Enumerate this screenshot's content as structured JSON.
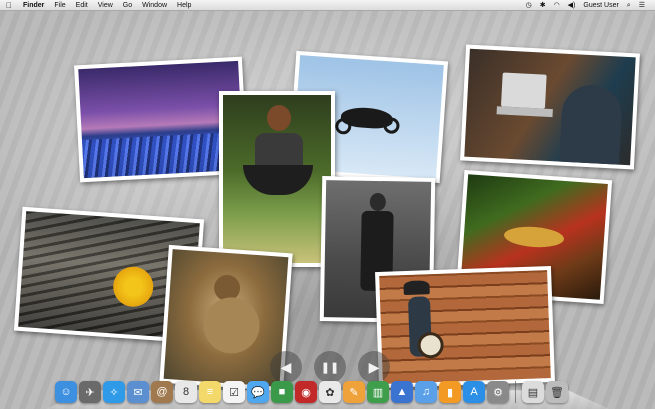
{
  "menubar": {
    "apple_icon": "apple-logo-icon",
    "app_name": "Finder",
    "items": [
      "File",
      "Edit",
      "View",
      "Go",
      "Window",
      "Help"
    ],
    "status_icons": [
      "wifi-icon",
      "bluetooth-icon",
      "speaker-icon",
      "time-machine-icon"
    ],
    "user_name": "Guest User",
    "extra_icons": [
      "search-icon",
      "list-icon"
    ]
  },
  "slideshow": {
    "photos": [
      {
        "name": "night-field-photo",
        "description_icon": "landscape"
      },
      {
        "name": "boy-on-swing-photo",
        "description_icon": "portrait"
      },
      {
        "name": "motocross-jump-photo",
        "description_icon": "sports"
      },
      {
        "name": "man-with-laptop-photo",
        "description_icon": "work"
      },
      {
        "name": "wood-chips-flower-photo",
        "description_icon": "nature"
      },
      {
        "name": "gosling-photo",
        "description_icon": "animal"
      },
      {
        "name": "soldier-in-rain-photo",
        "description_icon": "portrait"
      },
      {
        "name": "lizard-photo",
        "description_icon": "animal"
      },
      {
        "name": "banjo-player-photo",
        "description_icon": "music"
      }
    ],
    "controls": {
      "previous_icon": "previous-arrow-icon",
      "pause_icon": "pause-icon",
      "next_icon": "next-arrow-icon",
      "previous_glyph": "◀",
      "pause_glyph": "❚❚",
      "next_glyph": "▶"
    }
  },
  "dock": {
    "items": [
      {
        "name": "finder",
        "glyph": "☺",
        "color": "#3d8fe0"
      },
      {
        "name": "launchpad",
        "glyph": "✈",
        "color": "#6a6a6a"
      },
      {
        "name": "safari",
        "glyph": "✧",
        "color": "#2f9be8"
      },
      {
        "name": "mail",
        "glyph": "✉",
        "color": "#5b8fd0"
      },
      {
        "name": "contacts",
        "glyph": "@",
        "color": "#a07a4e"
      },
      {
        "name": "calendar",
        "glyph": "8",
        "color": "#e8e8e8"
      },
      {
        "name": "notes",
        "glyph": "≡",
        "color": "#f3d86a"
      },
      {
        "name": "reminders",
        "glyph": "☑",
        "color": "#f4f4f4"
      },
      {
        "name": "messages",
        "glyph": "💬",
        "color": "#4fa7f0"
      },
      {
        "name": "facetime",
        "glyph": "■",
        "color": "#3b9a4a"
      },
      {
        "name": "photo-booth",
        "glyph": "◉",
        "color": "#c22a2a"
      },
      {
        "name": "photos",
        "glyph": "✿",
        "color": "#e9e9e9"
      },
      {
        "name": "pages",
        "glyph": "✎",
        "color": "#f0a23a"
      },
      {
        "name": "numbers",
        "glyph": "▥",
        "color": "#3f9e4c"
      },
      {
        "name": "keynote",
        "glyph": "▲",
        "color": "#3a74d0"
      },
      {
        "name": "itunes",
        "glyph": "♫",
        "color": "#5aa0e8"
      },
      {
        "name": "ibooks",
        "glyph": "▮",
        "color": "#f39a25"
      },
      {
        "name": "app-store",
        "glyph": "A",
        "color": "#2c8fe6"
      },
      {
        "name": "system-preferences",
        "glyph": "⚙",
        "color": "#8a8a8a"
      },
      {
        "name": "documents",
        "glyph": "▤",
        "color": "#dcdcdc"
      },
      {
        "name": "trash",
        "glyph": "🗑",
        "color": "#bcbcbc"
      }
    ],
    "calendar_day": "8"
  },
  "colors": {
    "menubar_bg": "#e6e6e6",
    "desktop_bg": "#b8b8b8",
    "photo_border": "#ffffff"
  }
}
